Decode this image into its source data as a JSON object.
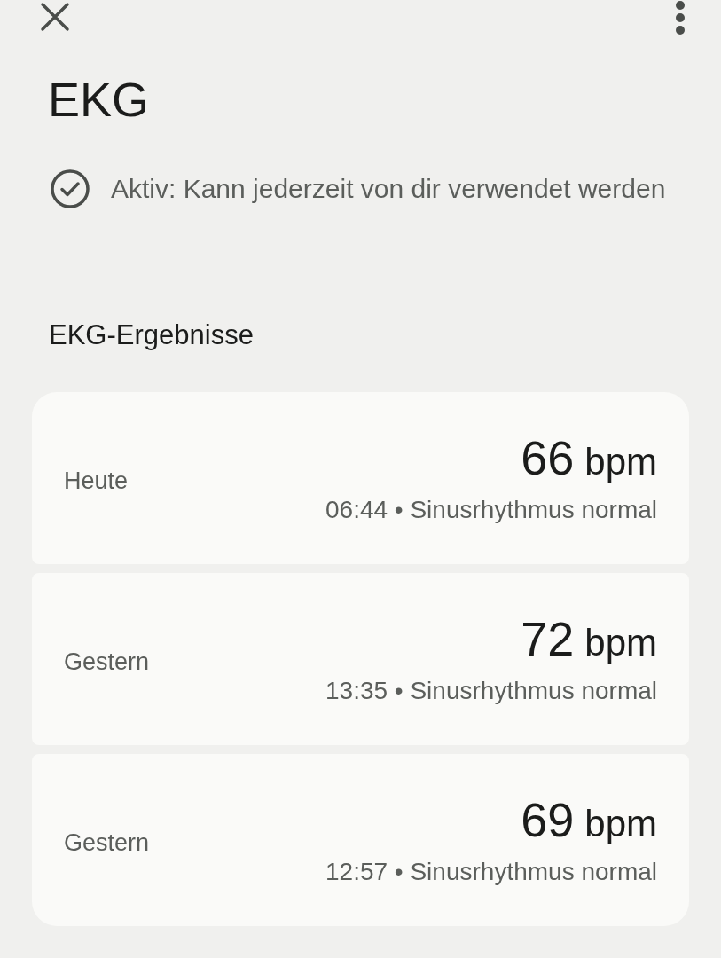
{
  "header": {
    "title": "EKG"
  },
  "status": {
    "text": "Aktiv: Kann jederzeit von dir verwendet werden"
  },
  "section_title": "EKG-Ergebnisse",
  "results": [
    {
      "day": "Heute",
      "value": "66",
      "unit": "bpm",
      "detail": "06:44 • Sinusrhythmus normal"
    },
    {
      "day": "Gestern",
      "value": "72",
      "unit": "bpm",
      "detail": "13:35 • Sinusrhythmus normal"
    },
    {
      "day": "Gestern",
      "value": "69",
      "unit": "bpm",
      "detail": "12:57 • Sinusrhythmus normal"
    }
  ]
}
